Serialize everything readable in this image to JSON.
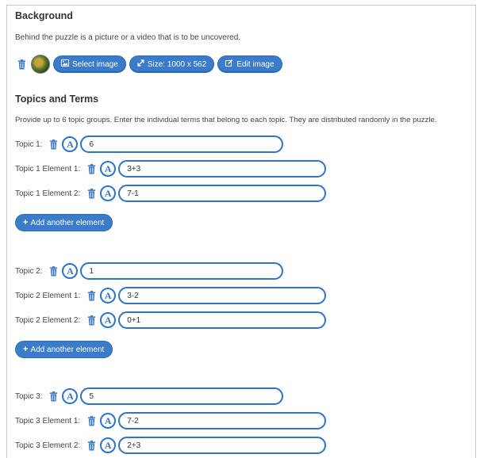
{
  "background": {
    "title": "Background",
    "description": "Behind the puzzle is a picture or a video that is to be uncovered.",
    "select_image_label": "Select image",
    "size_label": "Size: 1000 x 562",
    "edit_image_label": "Edit image"
  },
  "topics": {
    "title": "Topics and Terms",
    "description": "Provide up to 6 topic groups. Enter the individual terms that belong to each topic. They are distributed randomly in the puzzle.",
    "add_element_label": "Add another element",
    "font_button_label": "A",
    "groups": [
      {
        "label": "Topic 1:",
        "value": "6",
        "elements": [
          {
            "label": "Topic 1 Element 1:",
            "value": "3+3"
          },
          {
            "label": "Topic 1 Element 2:",
            "value": "7-1"
          }
        ]
      },
      {
        "label": "Topic 2:",
        "value": "1",
        "elements": [
          {
            "label": "Topic 2 Element 1:",
            "value": "3-2"
          },
          {
            "label": "Topic 2 Element 2:",
            "value": "0+1"
          }
        ]
      },
      {
        "label": "Topic 3:",
        "value": "5",
        "elements": [
          {
            "label": "Topic 3 Element 1:",
            "value": "7-2"
          },
          {
            "label": "Topic 3 Element 2:",
            "value": "2+3"
          }
        ]
      }
    ]
  },
  "colors": {
    "accent": "#2f73c2",
    "button": "#3a7cc9",
    "trash_icon": "#2f73c2"
  }
}
